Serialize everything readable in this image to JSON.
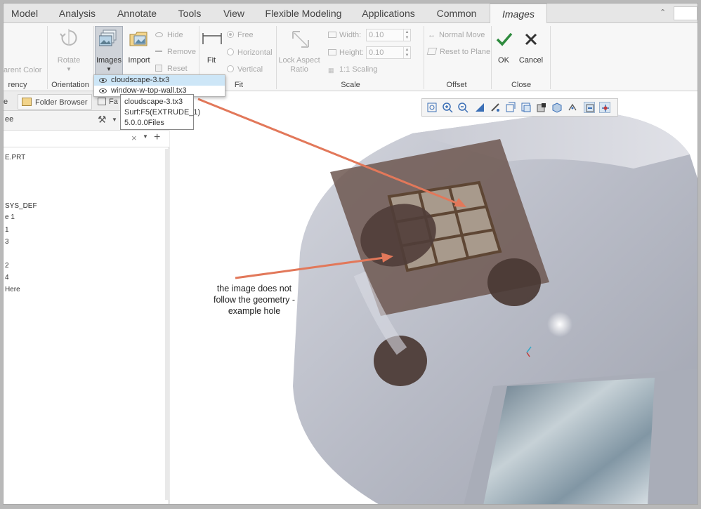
{
  "ribbon_tabs": [
    "Model",
    "Analysis",
    "Annotate",
    "Tools",
    "View",
    "Flexible Modeling",
    "Applications",
    "Common",
    "Images"
  ],
  "ribbon": {
    "transparent_color_label": "arent Color",
    "orientation": {
      "rotate_label": "Rotate",
      "group_label": "Orientation"
    },
    "images_btn_label": "Images",
    "import_label": "Import",
    "hide_label": "Hide",
    "remove_label": "Remove",
    "reset_label": "Reset",
    "transparency_group_label": "rency",
    "fit": {
      "fit_label": "Fit",
      "free_label": "Free",
      "horizontal_label": "Horizontal",
      "vertical_label": "Vertical",
      "group_label": "Fit"
    },
    "scale": {
      "lock_label_1": "Lock Aspect",
      "lock_label_2": "Ratio",
      "width_label": "Width:",
      "width_value": "0.10",
      "height_label": "Height:",
      "height_value": "0.10",
      "scaling_label": "1:1 Scaling",
      "group_label": "Scale"
    },
    "offset": {
      "normal_move_label": "Normal Move",
      "reset_plane_label": "Reset to Plane",
      "group_label": "Offset"
    },
    "close": {
      "ok_label": "OK",
      "cancel_label": "Cancel",
      "group_label": "Close"
    }
  },
  "images_menu": {
    "items": [
      "cloudscape-3.tx3",
      "window-w-top-wall.tx3"
    ],
    "selected": "cloudscape-3.tx3"
  },
  "tooltip": {
    "line1": "cloudscape-3.tx3",
    "line2": "Surf:F5(EXTRUDE_1)",
    "line3": "5.0.0.0Files"
  },
  "left_panel": {
    "tab_tree_label": "e",
    "tab_folder_label": "Folder Browser",
    "tab_fav_label": "Fa",
    "header_label": "ee",
    "tree": [
      "E.PRT",
      "",
      "",
      "",
      "SYS_DEF",
      "e 1",
      "1",
      "3",
      "",
      "2",
      "4",
      "Here"
    ]
  },
  "annotation": {
    "line1": "the image does not",
    "line2": "follow the geometry -",
    "line3": "example hole"
  },
  "colors": {
    "accent_blue": "#3b6fb6",
    "selection_blue": "#cde6f7",
    "arrow_orange": "#e2785a",
    "ok_green": "#2e8b3e"
  }
}
